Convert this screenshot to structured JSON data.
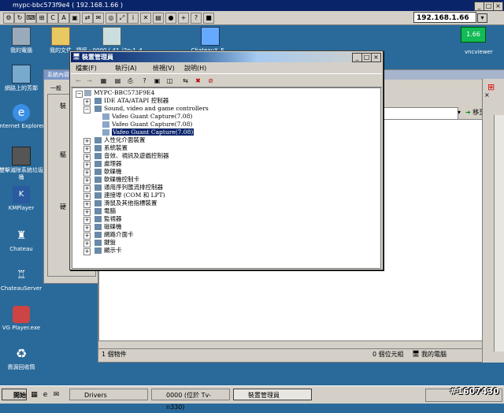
{
  "vnc": {
    "title": "mypc-bbc573f9e4 ( 192.168.1.66 )",
    "host": "192.168.1.66",
    "vncviewer_label": "vncviewer",
    "vnc_badge": "1.66"
  },
  "desktop": {
    "icons": [
      {
        "label": "我的電腦"
      },
      {
        "label": "網路上的芳鄰"
      },
      {
        "label": "Internet Explorer"
      },
      {
        "label": "雙擊滅除系統垃圾桶"
      },
      {
        "label": "KMPlayer"
      },
      {
        "label": "Chateau"
      },
      {
        "label": "ChateauServer"
      },
      {
        "label": "VG Player.exe"
      },
      {
        "label": "資源回收筒"
      },
      {
        "label": "我的文件"
      },
      {
        "label": "捷徑 - 0000 ( 41_i2n-1_4..."
      },
      {
        "label": "ChateauX_E..."
      }
    ]
  },
  "sysprops": {
    "title": "系統內容",
    "tab_general": "一般",
    "label_a": "裝",
    "label_b": "驅",
    "label_c": "硬"
  },
  "explorer": {
    "go_label": "移至",
    "status_objects": "1 個物件",
    "status_size": "0 個位元組",
    "status_location": "我的電腦"
  },
  "devmgr": {
    "title": "裝置管理員",
    "menu": [
      "檔案(F)",
      "執行(A)",
      "檢視(V)",
      "說明(H)"
    ],
    "root": "MYPC-BBC573F9E4",
    "nodes": [
      {
        "label": "IDE ATA/ATAPI 控制器",
        "expanded": false
      },
      {
        "label": "Sound, video and game controllers",
        "expanded": true
      },
      {
        "label": "Vafeo Guant Capture(7.08)",
        "child": true
      },
      {
        "label": "Vafeo Guant Capture(7.08)",
        "child": true
      },
      {
        "label": "Vafeo Guant Capture(7.08)",
        "child": true,
        "selected": true
      },
      {
        "label": "人性化介面裝置",
        "expanded": false
      },
      {
        "label": "系統裝置",
        "expanded": false
      },
      {
        "label": "音效、視訊及遊戲控制器",
        "expanded": false
      },
      {
        "label": "處理器",
        "expanded": false
      },
      {
        "label": "軟碟機",
        "expanded": false
      },
      {
        "label": "軟碟機控制卡",
        "expanded": false
      },
      {
        "label": "通用序列匯流排控制器",
        "expanded": false
      },
      {
        "label": "連接埠 (COM 和 LPT)",
        "expanded": false
      },
      {
        "label": "滑鼠及其他指標裝置",
        "expanded": false
      },
      {
        "label": "電腦",
        "expanded": false
      },
      {
        "label": "監視器",
        "expanded": false
      },
      {
        "label": "磁碟機",
        "expanded": false
      },
      {
        "label": "網路介面卡",
        "expanded": false
      },
      {
        "label": "鍵盤",
        "expanded": false
      },
      {
        "label": "顯示卡",
        "expanded": false
      }
    ]
  },
  "taskbar": {
    "start": "開始",
    "tasks": [
      "Drivers",
      "0000 (位於 Tv-n330)",
      "裝置管理員"
    ],
    "counter": "#1607430"
  }
}
